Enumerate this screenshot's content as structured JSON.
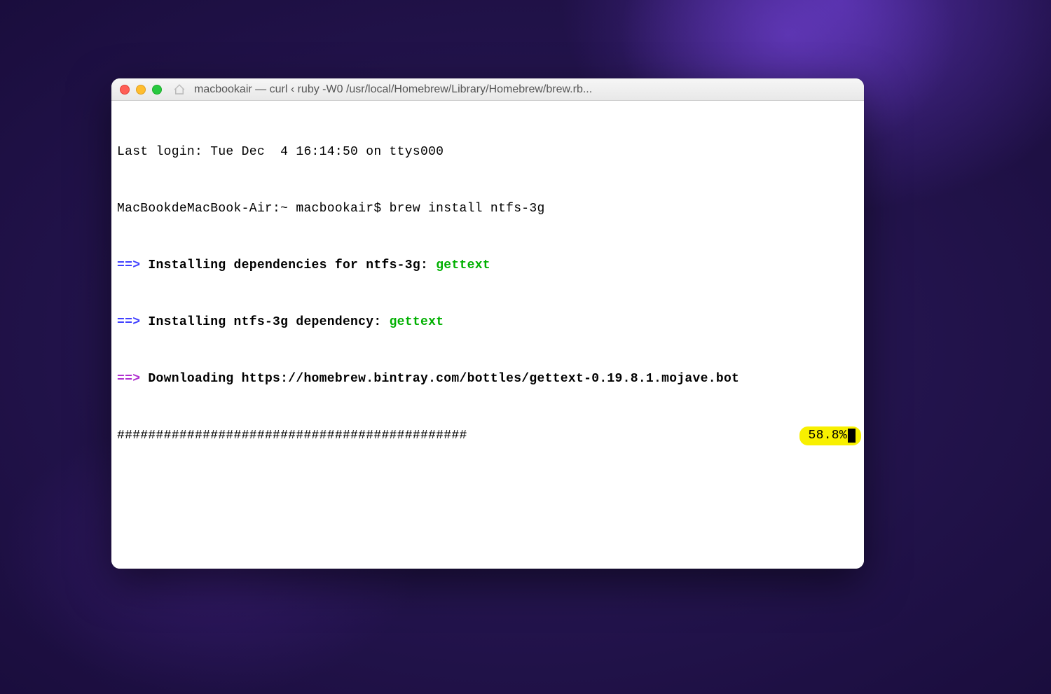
{
  "window": {
    "title": "macbookair — curl ‹ ruby -W0 /usr/local/Homebrew/Library/Homebrew/brew.rb..."
  },
  "terminal": {
    "line1": "Last login: Tue Dec  4 16:14:50 on ttys000",
    "prompt": "MacBookdeMacBook-Air:~ macbookair$ ",
    "command": "brew install ntfs-3g",
    "arrow": "==>",
    "install_deps_prefix": " Installing dependencies for ntfs-3g: ",
    "install_dep_prefix": " Installing ntfs-3g dependency: ",
    "dep_name": "gettext",
    "downloading": " Downloading https://homebrew.bintray.com/bottles/gettext-0.19.8.1.mojave.bot",
    "progress_bar": "#############################################",
    "progress_pct": "58.8%"
  },
  "colors": {
    "close": "#ff5f57",
    "minimize": "#ffbd2e",
    "maximize": "#28c940"
  }
}
